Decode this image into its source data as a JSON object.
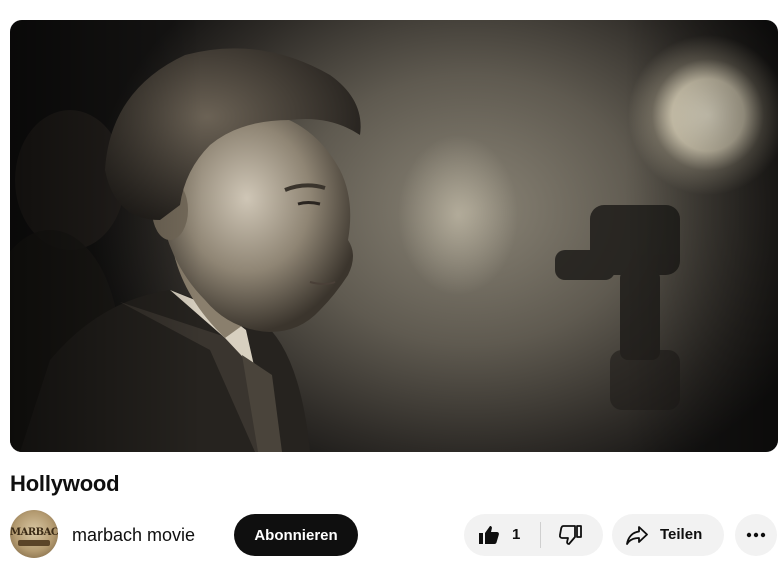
{
  "video": {
    "title": "Hollywood",
    "thumbnail_description_icon": "video-frame"
  },
  "channel": {
    "name": "marbach movie",
    "avatar_text": "MARBACH"
  },
  "actions": {
    "subscribe_label": "Abonnieren",
    "like_count": "1",
    "share_label": "Teilen",
    "like_icon": "thumbs-up-icon",
    "dislike_icon": "thumbs-down-icon",
    "share_icon": "share-arrow-icon",
    "more_icon": "more-horizontal-icon"
  },
  "colors": {
    "subscribe_bg": "#0f0f0f",
    "pill_bg": "#f2f2f2"
  }
}
